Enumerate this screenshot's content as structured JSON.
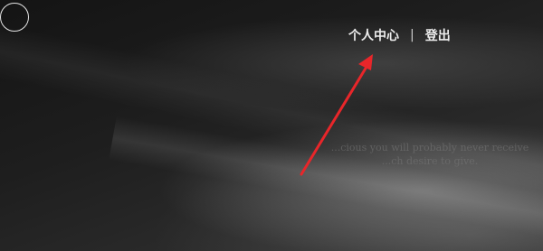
{
  "header": {
    "nav": {
      "personal_center": "个人中心",
      "separator": "|",
      "logout": "登出"
    }
  },
  "background": {
    "quote_line1": "...cious you will probably never receive",
    "quote_line2": "...ch desire to give."
  },
  "annotation": {
    "arrow_color": "#e8262a"
  }
}
